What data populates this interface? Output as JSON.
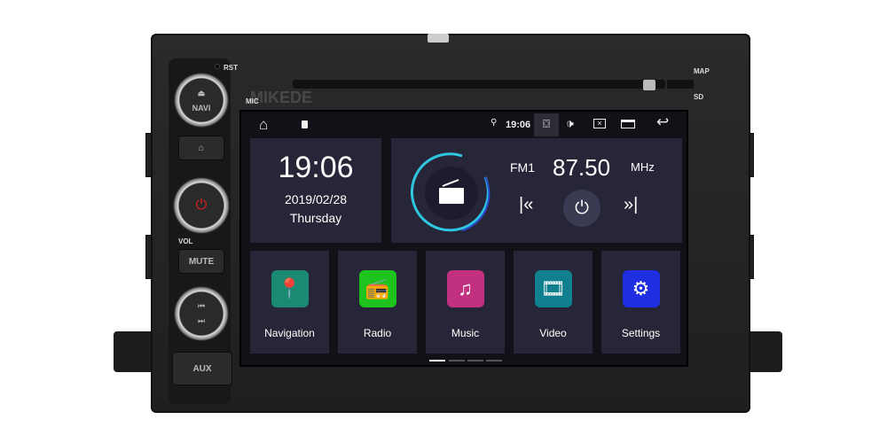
{
  "device": {
    "labels": {
      "rst": "RST",
      "mic": "MIC",
      "map": "MAP",
      "sd": "SD",
      "vol": "VOL"
    },
    "buttons": {
      "navi": "NAVI",
      "mute": "MUTE",
      "aux": "AUX"
    },
    "watermark": "KEDE"
  },
  "status_bar": {
    "time": "19:06",
    "icons": [
      "home-icon",
      "sd-card-icon",
      "location-icon",
      "camera-icon",
      "volume-icon",
      "close-window-icon",
      "recent-apps-icon",
      "back-icon"
    ]
  },
  "clock": {
    "time": "19:06",
    "date": "2019/02/28",
    "day": "Thursday"
  },
  "radio": {
    "band": "FM1",
    "frequency": "87.50",
    "unit": "MHz",
    "accent": "#29c6e0"
  },
  "apps": [
    {
      "label": "Navigation",
      "color": "#1a8a72",
      "icon": "map-pin-icon"
    },
    {
      "label": "Radio",
      "color": "#1ec31e",
      "icon": "radio-icon"
    },
    {
      "label": "Music",
      "color": "#c2317f",
      "icon": "music-note-icon"
    },
    {
      "label": "Video",
      "color": "#107f8e",
      "icon": "film-reel-icon"
    },
    {
      "label": "Settings",
      "color": "#1e2ee0",
      "icon": "gear-icon"
    }
  ],
  "pager": {
    "pages": 4,
    "current": 1
  }
}
